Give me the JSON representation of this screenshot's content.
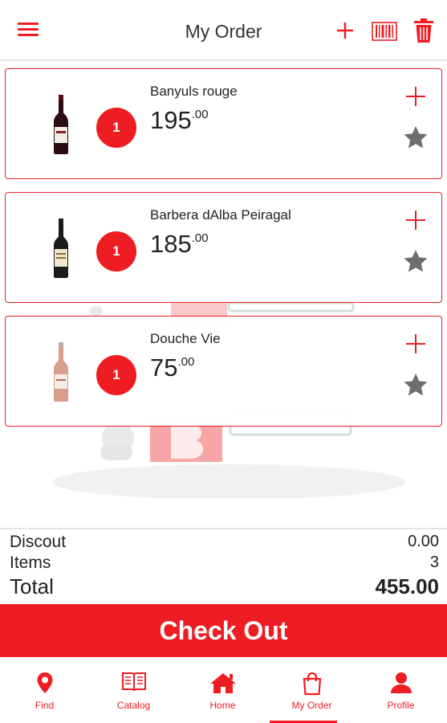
{
  "header": {
    "title": "My Order",
    "icons": [
      "menu-icon",
      "add-icon",
      "barcode-icon",
      "trash-icon"
    ]
  },
  "accent_color": "#ee1d23",
  "order": {
    "items": [
      {
        "name": "Banyuls rouge",
        "quantity": "1",
        "price_int": "195",
        "price_dec": ".00",
        "bottle": "red-wine-bottle"
      },
      {
        "name": "Barbera dAlba Peiragal",
        "quantity": "1",
        "price_int": "185",
        "price_dec": ".00",
        "bottle": "red-wine-bottle"
      },
      {
        "name": "Douche Vie",
        "quantity": "1",
        "price_int": "75",
        "price_dec": ".00",
        "bottle": "rose-wine-bottle"
      }
    ]
  },
  "summary": {
    "discount_label": "Discout",
    "discount_value": "0.00",
    "items_label": "Items",
    "items_value": "3",
    "total_label": "Total",
    "total_value": "455.00"
  },
  "checkout_label": "Check Out",
  "nav": {
    "items": [
      {
        "label": "Find",
        "icon": "location-pin-icon"
      },
      {
        "label": "Catalog",
        "icon": "book-icon"
      },
      {
        "label": "Home",
        "icon": "home-icon"
      },
      {
        "label": "My Order",
        "icon": "shopping-bag-icon",
        "active": true
      },
      {
        "label": "Profile",
        "icon": "user-icon"
      }
    ]
  }
}
